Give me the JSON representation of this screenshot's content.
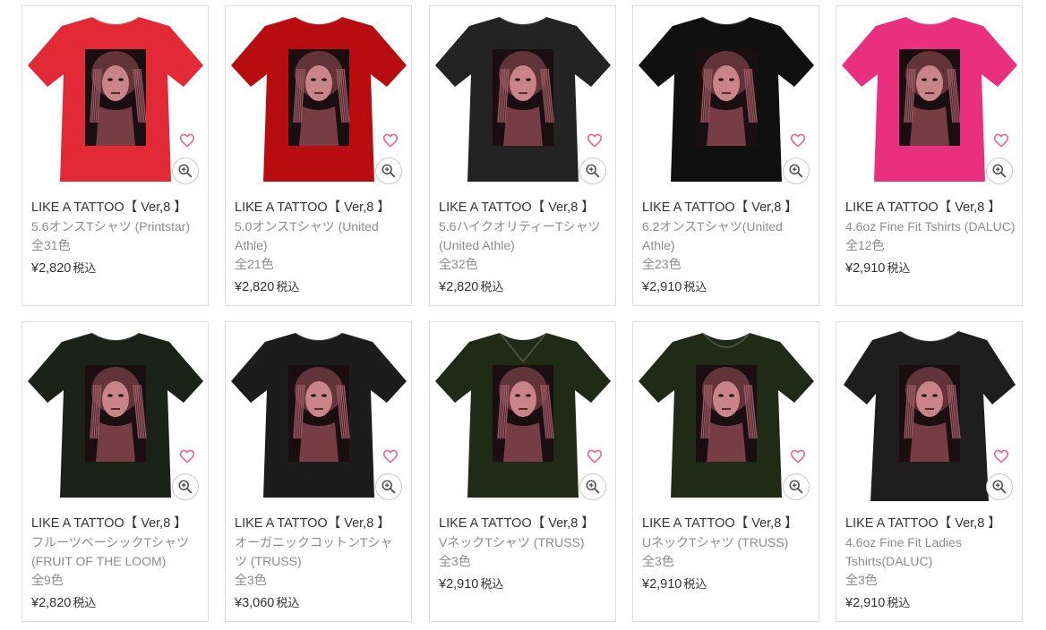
{
  "colors": {
    "heart": "#e8668a",
    "zoom_icon": "#555555",
    "print_bg": "#1a0e10",
    "print_text": "#d4111c",
    "print_face": "#c9848a"
  },
  "products": [
    {
      "title": "LIKE A TATTOO【 Ver,8 】",
      "subtitle": "5.6オンスTシャツ (Printstar)",
      "colors": "全31色",
      "price": "¥2,820",
      "tax": "税込",
      "shirt_color": "#e12a35",
      "style": "crew"
    },
    {
      "title": "LIKE A TATTOO【 Ver,8 】",
      "subtitle": "5.0オンスTシャツ (United Athle)",
      "colors": "全21色",
      "price": "¥2,820",
      "tax": "税込",
      "shirt_color": "#b80d10",
      "style": "crew"
    },
    {
      "title": "LIKE A TATTOO【 Ver,8 】",
      "subtitle": "5.6ハイクオリティーTシャツ (United Athle)",
      "colors": "全32色",
      "price": "¥2,820",
      "tax": "税込",
      "shirt_color": "#232323",
      "style": "crew"
    },
    {
      "title": "LIKE A TATTOO【 Ver,8 】",
      "subtitle": "6.2オンスTシャツ(United Athle)",
      "colors": "全23色",
      "price": "¥2,910",
      "tax": "税込",
      "shirt_color": "#101010",
      "style": "crew"
    },
    {
      "title": "LIKE A TATTOO【 Ver,8 】",
      "subtitle": "4.6oz Fine Fit Tshirts (DALUC)",
      "colors": "全12色",
      "price": "¥2,910",
      "tax": "税込",
      "shirt_color": "#e8307e",
      "style": "crew"
    },
    {
      "title": "LIKE A TATTOO【 Ver,8 】",
      "subtitle": "フルーツベーシックTシャツ (FRUIT OF THE LOOM)",
      "colors": "全9色",
      "price": "¥2,820",
      "tax": "税込",
      "shirt_color": "#1b2218",
      "style": "crew"
    },
    {
      "title": "LIKE A TATTOO【 Ver,8 】",
      "subtitle": "オーガニックコットンTシャツ (TRUSS)",
      "colors": "全3色",
      "price": "¥3,060",
      "tax": "税込",
      "shirt_color": "#1c1c1c",
      "style": "crew"
    },
    {
      "title": "LIKE A TATTOO【 Ver,8 】",
      "subtitle": "VネックTシャツ (TRUSS)",
      "colors": "全3色",
      "price": "¥2,910",
      "tax": "税込",
      "shirt_color": "#1f2a17",
      "style": "vneck"
    },
    {
      "title": "LIKE A TATTOO【 Ver,8 】",
      "subtitle": "UネックTシャツ (TRUSS)",
      "colors": "全3色",
      "price": "¥2,910",
      "tax": "税込",
      "shirt_color": "#1f2a17",
      "style": "uneck"
    },
    {
      "title": "LIKE A TATTOO【 Ver,8 】",
      "subtitle": "4.6oz Fine Fit Ladies Tshirts(DALUC)",
      "colors": "全3色",
      "price": "¥2,910",
      "tax": "税込",
      "shirt_color": "#1e1e1e",
      "style": "ladies"
    }
  ]
}
